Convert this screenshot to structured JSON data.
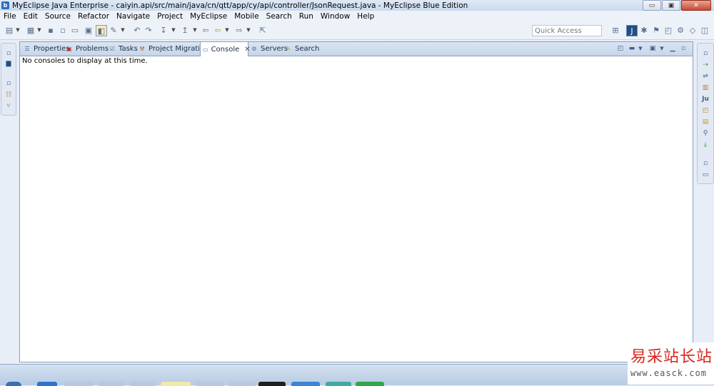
{
  "window": {
    "title": "MyEclipse Java Enterprise - caiyin.api/src/main/java/cn/qtt/app/cy/api/controller/JsonRequest.java - MyEclipse Blue Edition",
    "buttons": {
      "minimize": "▭",
      "maximize": "▣",
      "close": "✕"
    }
  },
  "menu": [
    "File",
    "Edit",
    "Source",
    "Refactor",
    "Navigate",
    "Project",
    "MyEclipse",
    "Mobile",
    "Search",
    "Run",
    "Window",
    "Help"
  ],
  "toolbar": {
    "quick_access_placeholder": "Quick Access"
  },
  "tabs": [
    {
      "label": "Properties",
      "icon": "properties-icon"
    },
    {
      "label": "Problems",
      "icon": "problems-icon"
    },
    {
      "label": "Tasks",
      "icon": "tasks-icon"
    },
    {
      "label": "Project Migration",
      "icon": "migration-icon"
    },
    {
      "label": "Console",
      "icon": "console-icon",
      "active": true
    },
    {
      "label": "Servers",
      "icon": "servers-icon"
    },
    {
      "label": "Search",
      "icon": "search-icon"
    }
  ],
  "console": {
    "message": "No consoles to display at this time."
  },
  "watermark": {
    "name": "易采站长站",
    "url": "www.easck.com"
  },
  "colors": {
    "title_bar": "#c9d9ee",
    "panel_border": "#8aa1bf",
    "watermark_red": "#d9251c"
  }
}
